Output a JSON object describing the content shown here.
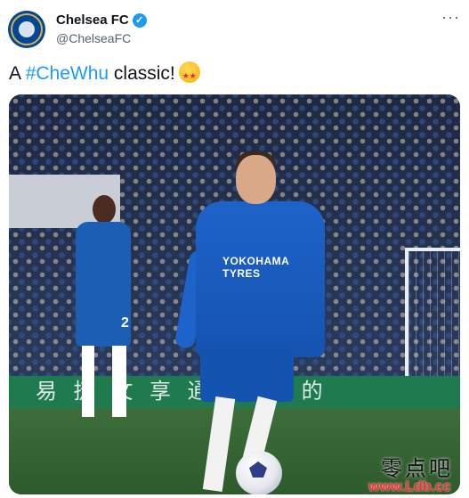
{
  "account": {
    "name": "Chelsea FC",
    "handle": "@ChelseaFC"
  },
  "icons": {
    "avatar": "chelsea-crest",
    "verified": "verified-badge",
    "more": "more-options-icon",
    "emoji": "star-struck-emoji"
  },
  "colors": {
    "hashtag": "#1d9bf0",
    "verified": "#1d9bf0",
    "club_blue": "#034694"
  },
  "tweet": {
    "prefix": "A ",
    "hashtag": "#CheWhu",
    "suffix": " classic!"
  },
  "media": {
    "banner_text": "易 捷  文 享  通 全 球 的",
    "players": [
      {
        "number": "2"
      }
    ],
    "sponsor": "YOKOHAMA TYRES",
    "watermark_cn": "零点吧",
    "watermark_url": "www.Ldb.cc"
  }
}
